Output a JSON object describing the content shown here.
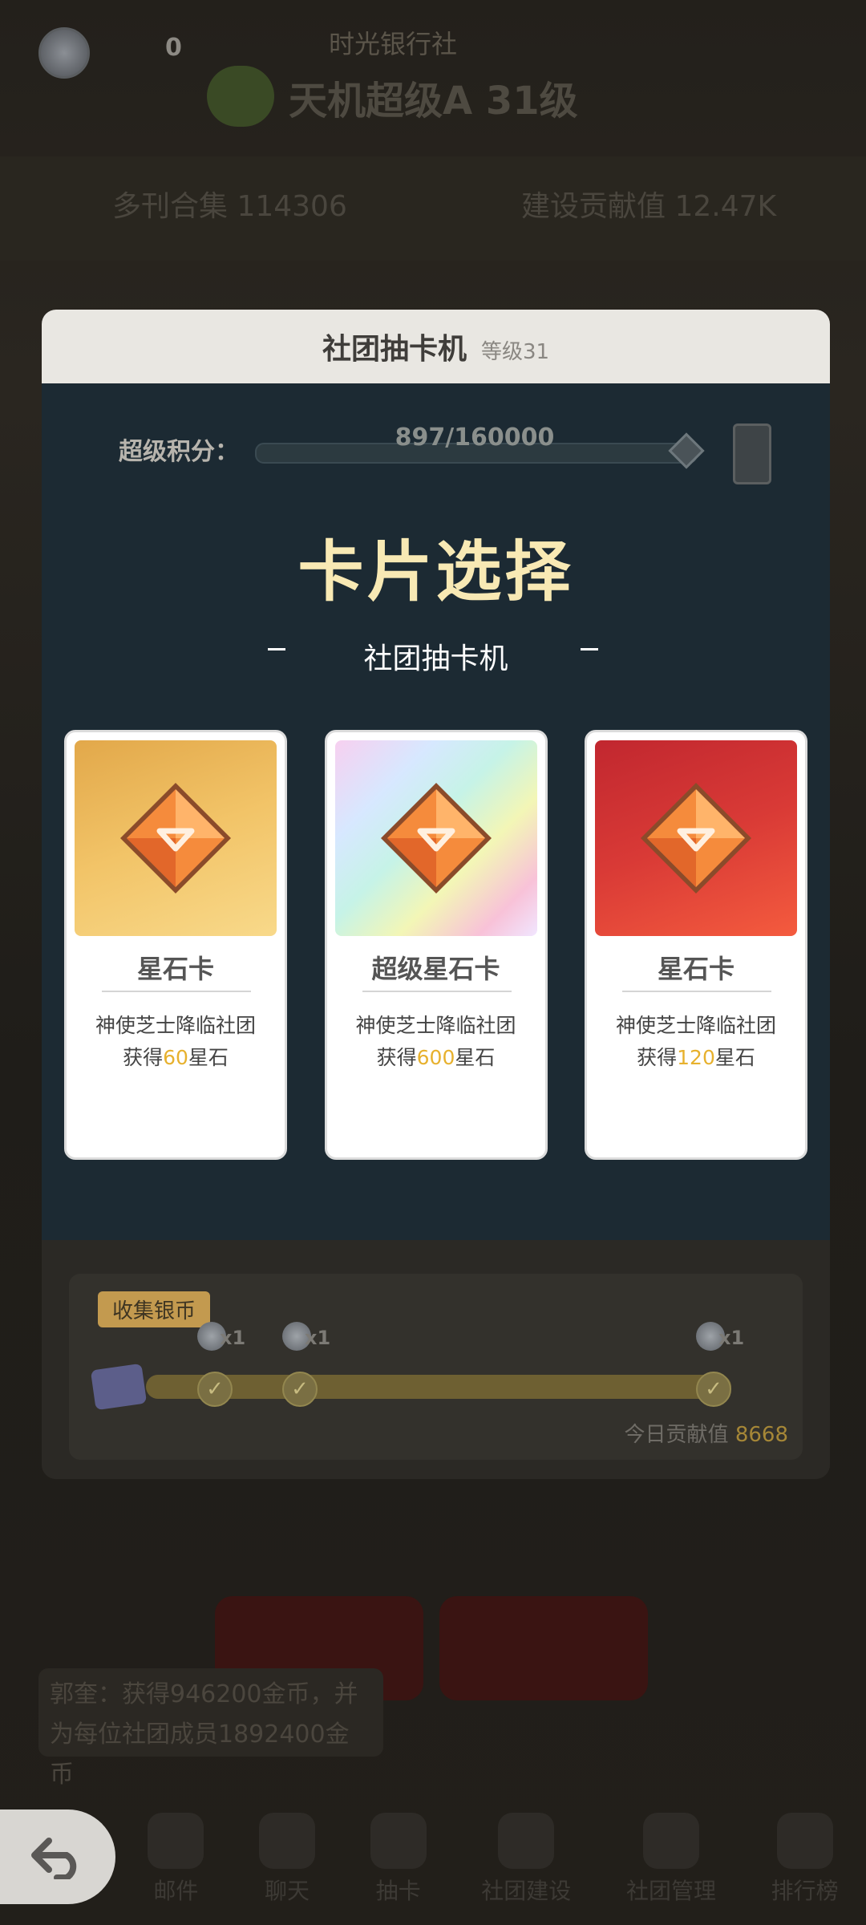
{
  "background": {
    "coin_count": "0",
    "shop_label": "时光银行社",
    "club_name": "天机超级A 31级",
    "strip_text": "多刊合集 114306",
    "strip_right": "建设贡献值 12.47K",
    "notice": "郭奎：获得946200金币，并为每位社团成员1892400金币",
    "nav": [
      "邮件",
      "聊天",
      "抽卡",
      "社团建设",
      "社团管理",
      "排行榜"
    ]
  },
  "modal": {
    "title": "社团抽卡机",
    "level": "等级31",
    "score_label": "超级积分：",
    "score_value": "897/160000",
    "big_title": "卡片选择",
    "subtitle": "社团抽卡机",
    "cards": [
      {
        "name": "星石卡",
        "desc1": "神使芝士降临社团",
        "desc2_pre": "获得",
        "amount": "60",
        "desc2_post": "星石",
        "art": "gold"
      },
      {
        "name": "超级星石卡",
        "desc1": "神使芝士降临社团",
        "desc2_pre": "获得",
        "amount": "600",
        "desc2_post": "星石",
        "art": "rainbow"
      },
      {
        "name": "星石卡",
        "desc1": "神使芝士降临社团",
        "desc2_pre": "获得",
        "amount": "120",
        "desc2_post": "星石",
        "art": "red"
      }
    ],
    "collect": {
      "tag": "收集银币",
      "reward_labels": [
        "x1",
        "x1",
        "x1"
      ],
      "contrib_label": "今日贡献值",
      "contrib_value": "8668"
    }
  },
  "colors": {
    "highlight": "#e7b12e",
    "panel": "#1c2a33",
    "title_gold": "#f8e9b4"
  },
  "icons": [
    "back-arrow-icon",
    "star-gem-icon",
    "silver-coin-icon",
    "check-icon",
    "trophy-icon",
    "ticket-icon"
  ]
}
